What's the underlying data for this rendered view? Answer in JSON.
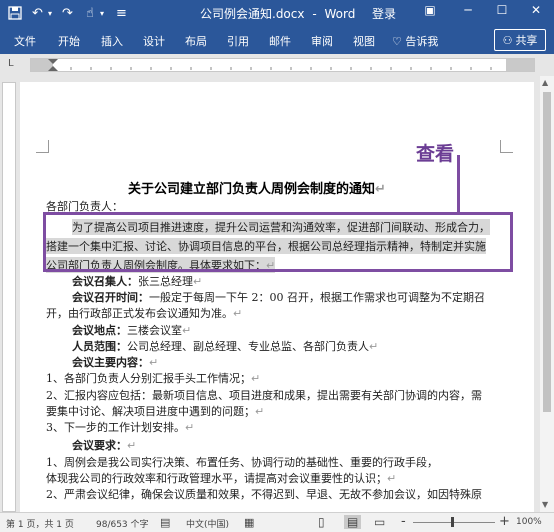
{
  "titlebar": {
    "doc_title": "公司例会通知.docx",
    "separator": "-",
    "app": "Word",
    "login": "登录"
  },
  "ribbon": {
    "tabs": [
      "文件",
      "开始",
      "插入",
      "设计",
      "布局",
      "引用",
      "邮件",
      "审阅",
      "视图"
    ],
    "tell_me": "告诉我",
    "share": "共享"
  },
  "callout": {
    "label": "查看"
  },
  "document": {
    "heading": "关于公司建立部门负责人周例会制度的通知",
    "lines": [
      {
        "text": "各部门负责人：",
        "highlight": false
      },
      {
        "text": "为了提高公司项目推进速度，提升公司运营和沟通效率，促进部门间联动、形成合力，",
        "highlight": true
      },
      {
        "text": "搭建一个集中汇报、讨论、协调项目信息的平台，根据公司总经理指示精神，特制定并实施",
        "highlight": true
      },
      {
        "text": "公司部门负责人周例会制度。具体要求如下：",
        "highlight": true
      },
      {
        "label": "会议召集人：",
        "text": "张三总经理"
      },
      {
        "label": "会议召开时间：",
        "text": "一般定于每周一下午 2：00 召开，根据工作需求也可调整为不定期召"
      },
      {
        "text": "开，由行政部正式发布会议通知为准。"
      },
      {
        "label": "会议地点：",
        "text": "三楼会议室"
      },
      {
        "label": "人员范围：",
        "text": "公司总经理、副总经理、专业总监、各部门负责人"
      },
      {
        "label": "会议主要内容：",
        "text": ""
      },
      {
        "text": "1、各部门负责人分别汇报手头工作情况；"
      },
      {
        "text": "2、汇报内容应包括：最新项目信息、项目进度和成果，提出需要有关部门协调的内容，需"
      },
      {
        "text": "要集中讨论、解决项目进度中遇到的问题；"
      },
      {
        "text": "3、下一步的工作计划安排。"
      },
      {
        "label": "会议要求：",
        "text": ""
      },
      {
        "text": "1、周例会是我公司实行决策、布置任务、协调行动的基础性、重要的行政手段，"
      },
      {
        "text": "体现我公司的行政效率和行政管理水平，请提高对会议重要性的认识；"
      },
      {
        "text": "2、严肃会议纪律，确保会议质量和效果，不得迟到、早退、无故不参加会议，如因特殊原"
      }
    ]
  },
  "status": {
    "page": "第 1 页，共 1 页",
    "words": "98/653 个字",
    "lang": "中文(中国)",
    "zoom_minus": "-",
    "zoom_plus": "+",
    "zoom": "100%"
  },
  "colors": {
    "word_blue": "#2b579a",
    "callout_purple": "#7e4da2"
  },
  "icons": {
    "save": "save-icon",
    "undo": "undo-icon",
    "redo": "redo-icon",
    "touch": "touch-mode-icon",
    "customize": "customize-toolbar-icon",
    "ribbon_opts": "ribbon-display-options-icon",
    "minimize": "minimize-icon",
    "maximize": "maximize-icon",
    "close": "close-icon",
    "lightbulb": "lightbulb-icon",
    "share": "person-icon"
  }
}
